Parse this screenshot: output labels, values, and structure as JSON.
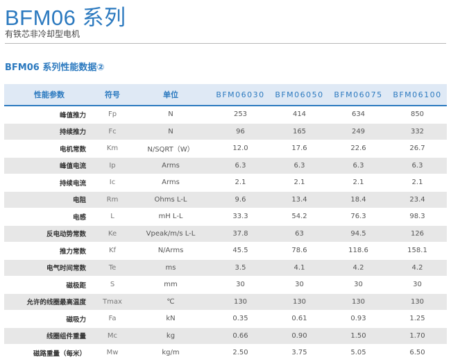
{
  "header": {
    "title": "BFM06 系列",
    "subtitle": "有铁芯非冷却型电机",
    "section": "BFM06 系列性能数据②"
  },
  "table": {
    "columns": [
      "性能参数",
      "符号",
      "单位",
      "BFM06030",
      "BFM06050",
      "BFM06075",
      "BFM06100"
    ],
    "rows": [
      {
        "name": "峰值推力",
        "symbol": "Fp",
        "unit": "N",
        "v": [
          "253",
          "414",
          "634",
          "850"
        ]
      },
      {
        "name": "持续推力",
        "symbol": "Fc",
        "unit": "N",
        "v": [
          "96",
          "165",
          "249",
          "332"
        ]
      },
      {
        "name": "电机常数",
        "symbol": "Km",
        "unit": "N/SQRT（W）",
        "v": [
          "12.0",
          "17.6",
          "22.6",
          "26.7"
        ]
      },
      {
        "name": "峰值电流",
        "symbol": "Ip",
        "unit": "Arms",
        "v": [
          "6.3",
          "6.3",
          "6.3",
          "6.3"
        ]
      },
      {
        "name": "持续电流",
        "symbol": "Ic",
        "unit": "Arms",
        "v": [
          "2.1",
          "2.1",
          "2.1",
          "2.1"
        ]
      },
      {
        "name": "电阻",
        "symbol": "Rm",
        "unit": "Ohms L-L",
        "v": [
          "9.6",
          "13.4",
          "18.4",
          "23.4"
        ]
      },
      {
        "name": "电感",
        "symbol": "L",
        "unit": "mH L-L",
        "v": [
          "33.3",
          "54.2",
          "76.3",
          "98.3"
        ]
      },
      {
        "name": "反电动势常数",
        "symbol": "Ke",
        "unit": "Vpeak/m/s L-L",
        "v": [
          "37.8",
          "63",
          "94.5",
          "126"
        ]
      },
      {
        "name": "推力常数",
        "symbol": "Kf",
        "unit": "N/Arms",
        "v": [
          "45.5",
          "78.6",
          "118.6",
          "158.1"
        ]
      },
      {
        "name": "电气时间常数",
        "symbol": "Te",
        "unit": "ms",
        "v": [
          "3.5",
          "4.1",
          "4.2",
          "4.2"
        ]
      },
      {
        "name": "磁极距",
        "symbol": "S",
        "unit": "mm",
        "v": [
          "30",
          "30",
          "30",
          "30"
        ]
      },
      {
        "name": "允许的线圈最高温度",
        "symbol": "Tmax",
        "unit": "℃",
        "v": [
          "130",
          "130",
          "130",
          "130"
        ]
      },
      {
        "name": "磁吸力",
        "symbol": "Fa",
        "unit": "kN",
        "v": [
          "0.35",
          "0.61",
          "0.93",
          "1.25"
        ]
      },
      {
        "name": "线圈组件重量",
        "symbol": "Mc",
        "unit": "kg",
        "v": [
          "0.66",
          "0.90",
          "1.50",
          "1.70"
        ]
      },
      {
        "name": "磁路重量（每米）",
        "symbol": "Mw",
        "unit": "kg/m",
        "v": [
          "2.50",
          "3.75",
          "5.05",
          "6.50"
        ]
      }
    ]
  }
}
